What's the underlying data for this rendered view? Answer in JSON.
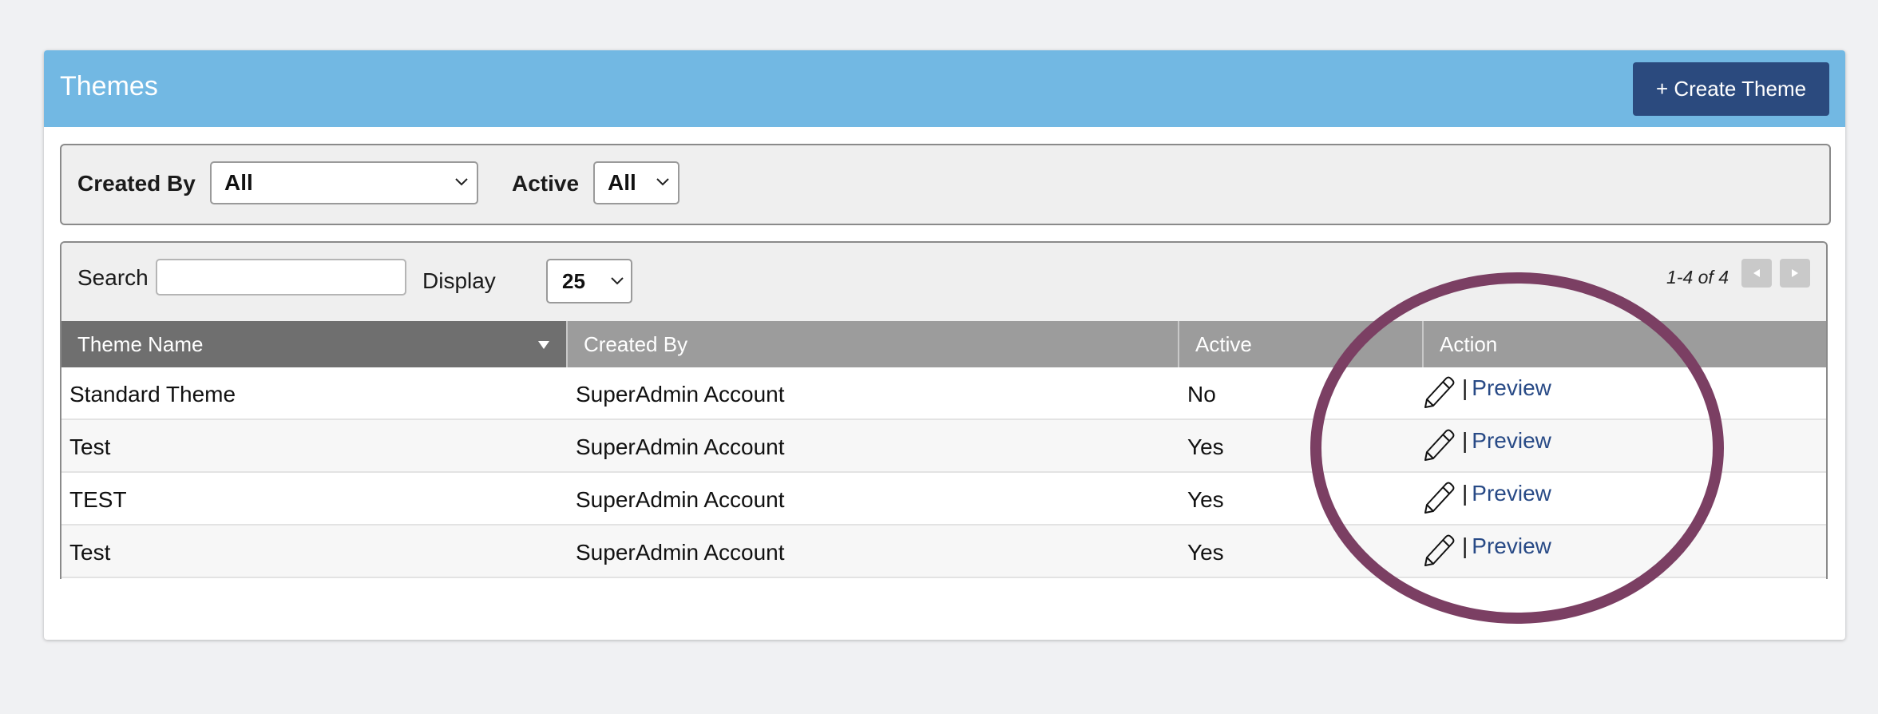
{
  "header": {
    "title": "Themes",
    "create_button_label": "+ Create Theme"
  },
  "filters": {
    "created_by_label": "Created By",
    "created_by_value": "All",
    "active_label": "Active",
    "active_value": "All"
  },
  "toolbar": {
    "search_label": "Search",
    "search_value": "",
    "display_label": "Display",
    "display_value": "25",
    "paging_text": "1-4 of 4",
    "prev_icon": "triangle-left-icon",
    "next_icon": "triangle-right-icon"
  },
  "table": {
    "columns": [
      {
        "label": "Theme Name",
        "sorted": true
      },
      {
        "label": "Created By"
      },
      {
        "label": "Active"
      },
      {
        "label": "Action"
      }
    ],
    "rows": [
      {
        "theme_name": "Standard Theme",
        "created_by": "SuperAdmin Account",
        "active": "No",
        "separator": "|",
        "preview": "Preview"
      },
      {
        "theme_name": "Test",
        "created_by": "SuperAdmin Account",
        "active": "Yes",
        "separator": "|",
        "preview": "Preview"
      },
      {
        "theme_name": "TEST",
        "created_by": "SuperAdmin Account",
        "active": "Yes",
        "separator": "|",
        "preview": "Preview"
      },
      {
        "theme_name": "Test",
        "created_by": "SuperAdmin Account",
        "active": "Yes",
        "separator": "|",
        "preview": "Preview"
      }
    ]
  },
  "colors": {
    "header_bg": "#72b8e3",
    "button_bg": "#2b4a7e",
    "annotation_ring": "#7b3f63",
    "link": "#284a86"
  }
}
